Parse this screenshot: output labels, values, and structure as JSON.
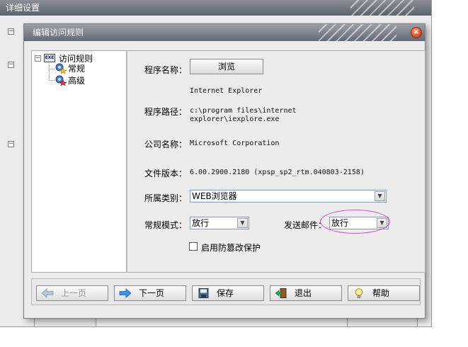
{
  "background_window": {
    "title": "详细设置"
  },
  "dialog": {
    "title": "编辑访问规则",
    "close_glyph": "×"
  },
  "tree": {
    "root": {
      "label": "访问规则",
      "icon_text": "EXE"
    },
    "children": [
      {
        "label": "常规"
      },
      {
        "label": "高级"
      }
    ]
  },
  "form": {
    "program_name_label": "程序名称：",
    "browse_label": "浏览",
    "program_name_value": "Internet Explorer",
    "program_path_label": "程序路径：",
    "program_path_line1": "c:\\program files\\internet",
    "program_path_line2": "explorer\\iexplore.exe",
    "company_label": "公司名称：",
    "company_value": "Microsoft Corporation",
    "version_label": "文件版本：",
    "version_value": "6.00.2900.2180 (xpsp_sp2_rtm.040803-2158)",
    "category_label": "所属类别：",
    "category_value": "WEB浏览器",
    "mode_label": "常规模式：",
    "mode_value": "放行",
    "mail_label": "发送邮件：",
    "mail_value": "放行",
    "tamper_label": "启用防篡改保护",
    "tamper_checked": false
  },
  "buttons": {
    "prev": "上一页",
    "next": "下一页",
    "save": "保存",
    "exit": "退出",
    "help": "帮助"
  },
  "colors": {
    "highlight": "#e040d8",
    "titlebar": "#646a73"
  }
}
